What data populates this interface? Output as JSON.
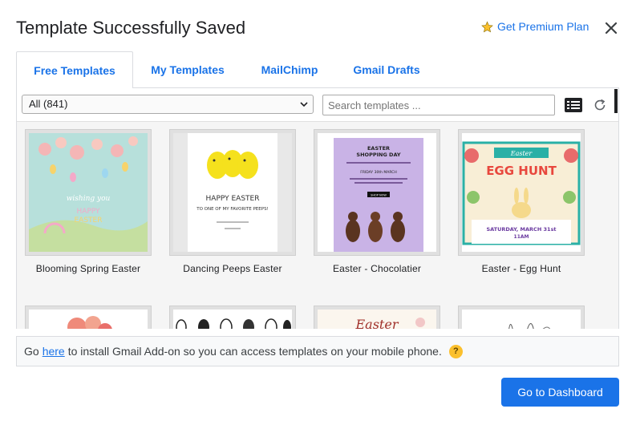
{
  "dialog": {
    "title": "Template Successfully Saved",
    "premium_label": "Get Premium Plan",
    "close_icon": "close-icon"
  },
  "tabs": [
    {
      "label": "Free Templates",
      "active": true
    },
    {
      "label": "My Templates",
      "active": false
    },
    {
      "label": "MailChimp",
      "active": false
    },
    {
      "label": "Gmail Drafts",
      "active": false
    }
  ],
  "toolbar": {
    "filter_value": "All (841)",
    "search_placeholder": "Search templates ...",
    "view_icon": "list-view-icon",
    "refresh_icon": "refresh-icon"
  },
  "templates": [
    {
      "label": "Blooming Spring Easter",
      "thumb_text": "Happy Easter"
    },
    {
      "label": "Dancing Peeps Easter",
      "thumb_text": "HAPPY EASTER",
      "thumb_sub": "TO ONE OF MY FAVORITE PEEPS!"
    },
    {
      "label": "Easter - Chocolatier",
      "thumb_text": "EASTER SHOPPING DAY",
      "thumb_sub": "FRIDAY 30th MARCH",
      "thumb_btn": "SHOP NOW"
    },
    {
      "label": "Easter - Egg Hunt",
      "thumb_text": "Easter",
      "thumb_sub": "EGG HUNT",
      "thumb_date": "SATURDAY, MARCH 31st",
      "thumb_time": "11AM"
    },
    {
      "label": "",
      "thumb_text": ""
    },
    {
      "label": "",
      "thumb_text": ""
    },
    {
      "label": "",
      "thumb_text": "Easter"
    },
    {
      "label": "",
      "thumb_text": ""
    }
  ],
  "notice": {
    "prefix": "Go",
    "link": "here",
    "suffix": "to install Gmail Add-on so you can access templates on your mobile phone.",
    "help": "?"
  },
  "footer": {
    "dashboard_label": "Go to Dashboard"
  },
  "colors": {
    "accent": "#1a73e8",
    "premium_star": "#fbc02d"
  }
}
